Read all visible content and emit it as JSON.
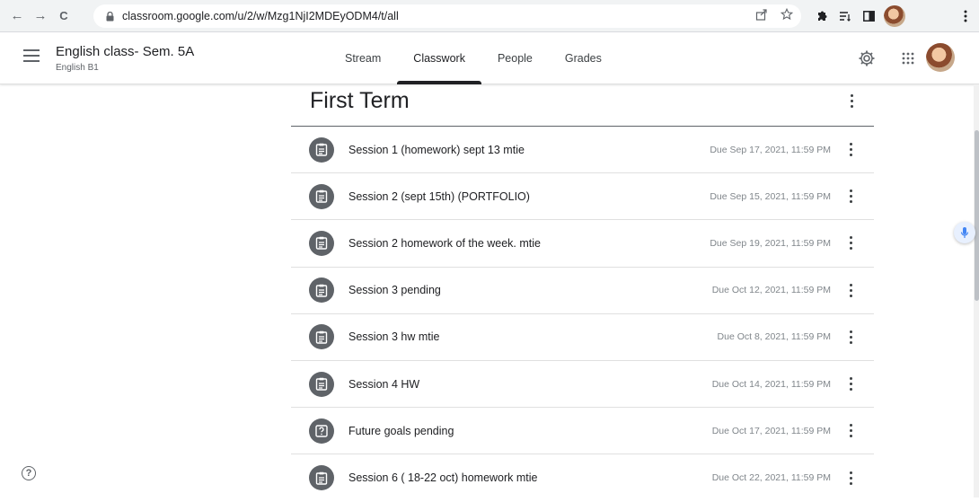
{
  "browser": {
    "back_glyph": "←",
    "forward_glyph": "→",
    "reload_glyph": "C",
    "url": "classroom.google.com/u/2/w/Mzg1NjI2MDEyODM4/t/all",
    "icons": [
      "share-icon",
      "bookmark-star-icon",
      "extensions-icon",
      "reading-list-icon",
      "side-panel-icon",
      "profile-avatar",
      "browser-menu-icon"
    ]
  },
  "header": {
    "class_name": "English class- Sem. 5A",
    "section": "English B1",
    "tabs": [
      {
        "label": "Stream",
        "active": false
      },
      {
        "label": "Classwork",
        "active": true
      },
      {
        "label": "People",
        "active": false
      },
      {
        "label": "Grades",
        "active": false
      }
    ]
  },
  "topic": {
    "title": "First Term"
  },
  "assignments": [
    {
      "title": "Session 1 (homework) sept 13 mtie",
      "due": "Due Sep 17, 2021, 11:59 PM",
      "icon": "assignment-icon"
    },
    {
      "title": "Session 2 (sept 15th) (PORTFOLIO)",
      "due": "Due Sep 15, 2021, 11:59 PM",
      "icon": "assignment-icon"
    },
    {
      "title": "Session 2 homework of the week. mtie",
      "due": "Due Sep 19, 2021, 11:59 PM",
      "icon": "assignment-icon"
    },
    {
      "title": "Session 3 pending",
      "due": "Due Oct 12, 2021, 11:59 PM",
      "icon": "assignment-icon"
    },
    {
      "title": "Session 3 hw mtie",
      "due": "Due Oct 8, 2021, 11:59 PM",
      "icon": "assignment-icon"
    },
    {
      "title": "Session 4 HW",
      "due": "Due Oct 14, 2021, 11:59 PM",
      "icon": "assignment-icon"
    },
    {
      "title": "Future goals pending",
      "due": "Due Oct 17, 2021, 11:59 PM",
      "icon": "question-icon"
    },
    {
      "title": "Session 6 ( 18-22 oct) homework mtie",
      "due": "Due Oct 22, 2021, 11:59 PM",
      "icon": "assignment-icon"
    }
  ],
  "help_glyph": "?",
  "colors": {
    "accent": "#202124",
    "icon_bg": "#5f6368",
    "due_text": "#80868b"
  }
}
